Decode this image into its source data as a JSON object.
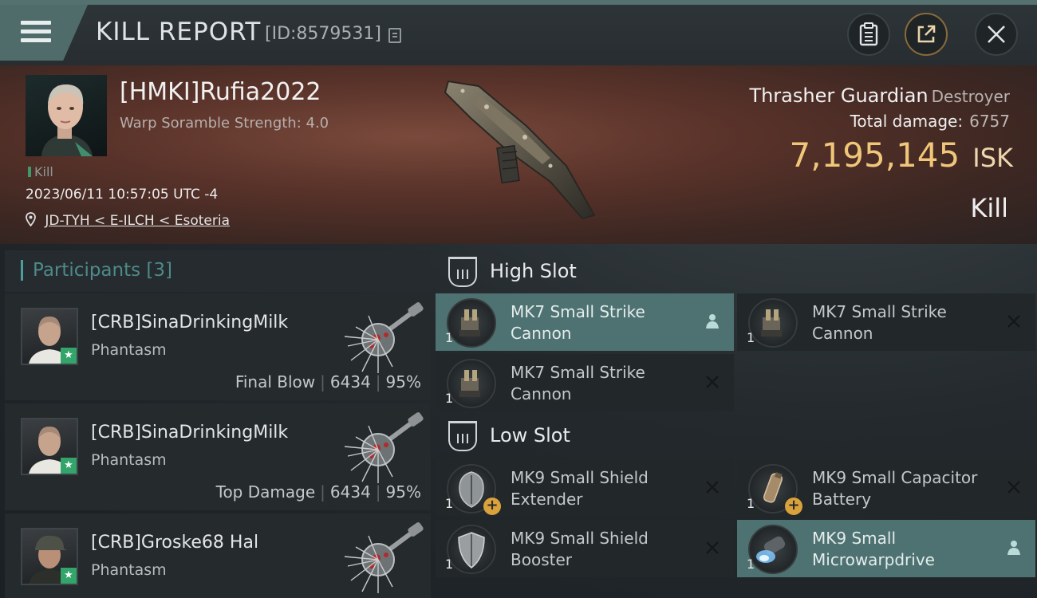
{
  "header": {
    "title": "KILL REPORT",
    "report_id": "[ID:8579531]"
  },
  "victim": {
    "pilot": "[HMKI]Rufia2022",
    "scramble": "Warp Soramble Strength: 4.0",
    "kill_tag": "Kill",
    "datetime": "2023/06/11 10:57:05 UTC -4",
    "location": "JD-TYH < E-ILCH < Esoteria",
    "ship_name": "Thrasher Guardian",
    "ship_class": "Destroyer",
    "total_damage_label": "Total damage:",
    "total_damage": "6757",
    "isk_value": "7,195,145",
    "isk_unit": "ISK",
    "kill_type": "Kill"
  },
  "participants": {
    "title": "Participants [3]",
    "rows": [
      {
        "name": "[CRB]SinaDrinkingMilk",
        "ship": "Phantasm",
        "role": "Final Blow",
        "damage": "6434",
        "percent": "95%"
      },
      {
        "name": "[CRB]SinaDrinkingMilk",
        "ship": "Phantasm",
        "role": "Top Damage",
        "damage": "6434",
        "percent": "95%"
      },
      {
        "name": "[CRB]Groske68 Hal",
        "ship": "Phantasm"
      }
    ]
  },
  "slots": {
    "high": {
      "title": "High Slot",
      "modules": [
        {
          "name": "MK7 Small Strike Cannon",
          "qty": "1",
          "status": "dropped"
        },
        {
          "name": "MK7 Small Strike Cannon",
          "qty": "1",
          "status": "destroyed"
        },
        {
          "name": "MK7 Small Strike Cannon",
          "qty": "1",
          "status": "destroyed"
        }
      ]
    },
    "low": {
      "title": "Low Slot",
      "modules": [
        {
          "name": "MK9 Small Shield Extender",
          "qty": "1",
          "status": "destroyed"
        },
        {
          "name": "MK9 Small Capacitor Battery",
          "qty": "1",
          "status": "destroyed"
        },
        {
          "name": "MK9 Small Shield Booster",
          "qty": "1",
          "status": "destroyed"
        },
        {
          "name": "MK9 Small Microwarpdrive",
          "qty": "1",
          "status": "dropped"
        }
      ]
    }
  },
  "colors": {
    "accent": "#4e7271",
    "isk": "#f0c67a",
    "kill_green": "#3e9a6a"
  }
}
